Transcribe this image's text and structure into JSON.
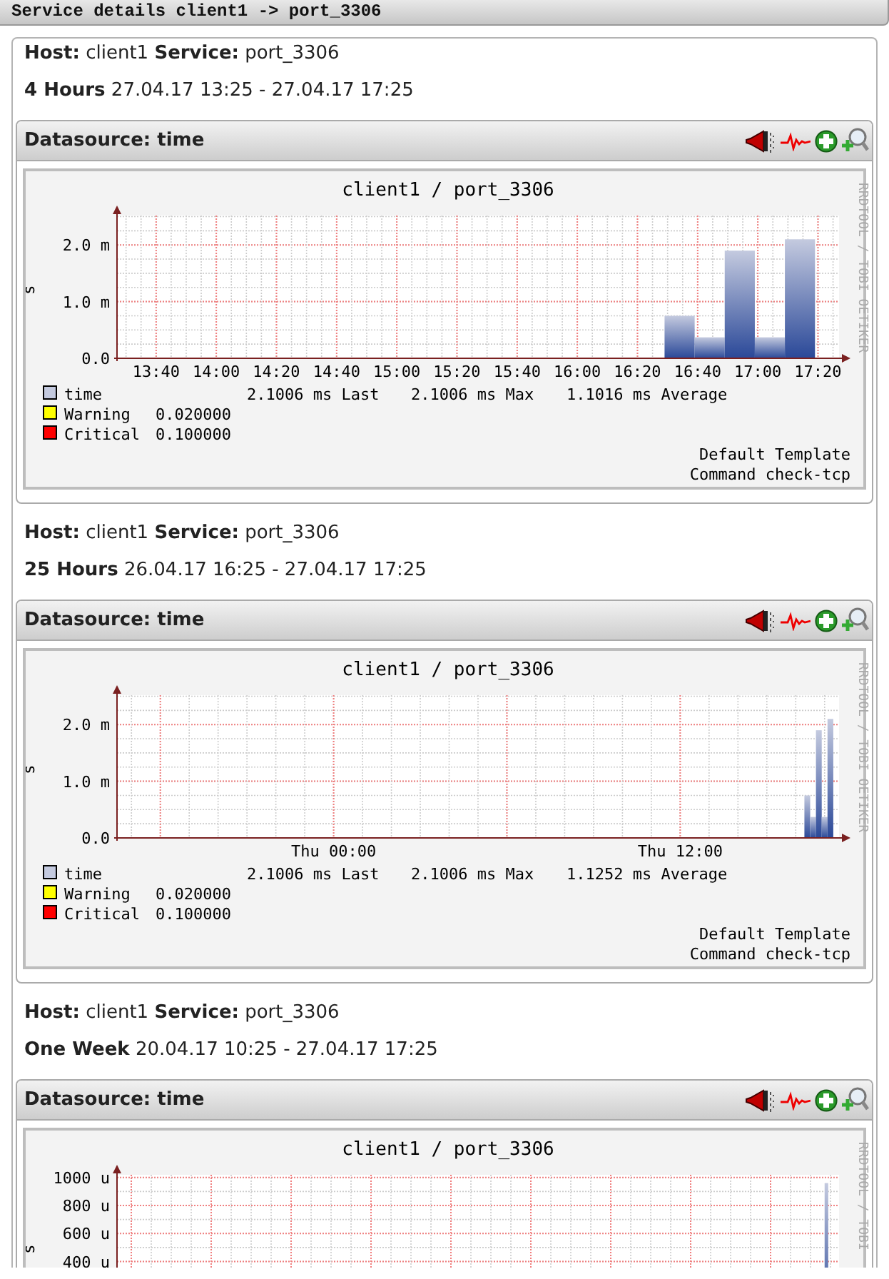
{
  "header": {
    "title": "Service details client1 -> port_3306"
  },
  "sections": [
    {
      "host_label": "Host:",
      "host": "client1",
      "service_label": "Service:",
      "service": "port_3306",
      "period": "4 Hours",
      "range": "27.04.17 13:25 - 27.04.17 17:25",
      "datasource": "Datasource: time",
      "graph": {
        "credit": "RRDTOOL / TOBI OETIKER",
        "legend": [
          {
            "stats": [
              "2.1006 ms Last",
              "2.1006 ms Max",
              "1.1016 ms Average"
            ]
          },
          {
            "label": "Warning",
            "color": "#ffff00",
            "value": "0.020000"
          },
          {
            "label": "Critical",
            "color": "#ff0000",
            "value": "0.100000"
          }
        ],
        "footer": [
          "Default Template",
          "Command check-tcp"
        ],
        "chart_data": {
          "type": "bar",
          "title": "client1 / port_3306",
          "ylabel": "s",
          "grid": true,
          "x": [
            994,
            1004,
            1014,
            1024,
            1034
          ],
          "series": [
            {
              "name": "time",
              "color": "#c4cadf",
              "values": [
                0.75,
                0.37,
                1.9,
                0.37,
                2.1
              ]
            }
          ],
          "xlim": [
            807,
            1047
          ],
          "ylim": [
            0,
            2.62
          ],
          "xticks": [
            {
              "value": 820,
              "label": "13:40"
            },
            {
              "value": 840,
              "label": "14:00"
            },
            {
              "value": 860,
              "label": "14:20"
            },
            {
              "value": 880,
              "label": "14:40"
            },
            {
              "value": 900,
              "label": "15:00"
            },
            {
              "value": 920,
              "label": "15:20"
            },
            {
              "value": 940,
              "label": "15:40"
            },
            {
              "value": 960,
              "label": "16:00"
            },
            {
              "value": 980,
              "label": "16:20"
            },
            {
              "value": 1000,
              "label": "16:40"
            },
            {
              "value": 1020,
              "label": "17:00"
            },
            {
              "value": 1040,
              "label": "17:20"
            }
          ],
          "yticks": [
            {
              "value": 0,
              "label": "0.0"
            },
            {
              "value": 1,
              "label": "1.0 m"
            },
            {
              "value": 2,
              "label": "2.0 m"
            }
          ]
        }
      }
    },
    {
      "host_label": "Host:",
      "host": "client1",
      "service_label": "Service:",
      "service": "port_3306",
      "period": "25 Hours",
      "range": "26.04.17 16:25 - 27.04.17 17:25",
      "datasource": "Datasource: time",
      "graph": {
        "credit": "RRDTOOL / TOBI OETIKER",
        "legend": [
          {
            "stats": [
              "2.1006 ms Last",
              "2.1006 ms Max",
              "1.1252 ms Average"
            ]
          },
          {
            "label": "Warning",
            "color": "#ffff00",
            "value": "0.020000"
          },
          {
            "label": "Critical",
            "color": "#ff0000",
            "value": "0.100000"
          }
        ],
        "footer": [
          "Default Template",
          "Command check-tcp"
        ],
        "chart_data": {
          "type": "bar",
          "title": "client1 / port_3306",
          "ylabel": "s",
          "grid": true,
          "categories": [
            null,
            null,
            null,
            null,
            null,
            null,
            null,
            null,
            null,
            null,
            null,
            null,
            null,
            null,
            null,
            null,
            null,
            null,
            null,
            null,
            null,
            null,
            null,
            null,
            null,
            null,
            null,
            null,
            null,
            null,
            null,
            null,
            null,
            null,
            null,
            null,
            null,
            "Thu 00:00",
            null,
            null,
            null,
            null,
            null,
            null,
            null,
            null,
            null,
            null,
            null,
            null,
            null,
            null,
            null,
            null,
            null,
            null,
            null,
            null,
            null,
            null,
            null,
            null,
            null,
            null,
            null,
            null,
            null,
            null,
            null,
            null,
            null,
            null,
            null,
            null,
            null,
            null,
            null,
            null,
            null,
            null,
            null,
            null,
            null,
            null,
            null,
            null,
            null,
            null,
            null,
            null,
            null,
            null,
            null,
            null,
            null,
            null,
            null,
            "Thu 12:00",
            null,
            null,
            null,
            null,
            null,
            null,
            null,
            null,
            null,
            null,
            null,
            null,
            null,
            null,
            null,
            null,
            null,
            null,
            null,
            null,
            null,
            null,
            null,
            null,
            null,
            null,
            null
          ],
          "series": [
            {
              "name": "time",
              "color": "#c4cadf",
              "values": [
                null,
                null,
                null,
                null,
                null,
                null,
                null,
                null,
                null,
                null,
                null,
                null,
                null,
                null,
                null,
                null,
                null,
                null,
                null,
                null,
                null,
                null,
                null,
                null,
                null,
                null,
                null,
                null,
                null,
                null,
                null,
                null,
                null,
                null,
                null,
                null,
                null,
                null,
                null,
                null,
                null,
                null,
                null,
                null,
                null,
                null,
                null,
                null,
                null,
                null,
                null,
                null,
                null,
                null,
                null,
                null,
                null,
                null,
                null,
                null,
                null,
                null,
                null,
                null,
                null,
                null,
                null,
                null,
                null,
                null,
                null,
                null,
                null,
                null,
                null,
                null,
                null,
                null,
                null,
                null,
                null,
                null,
                null,
                null,
                null,
                null,
                null,
                null,
                null,
                null,
                null,
                null,
                null,
                null,
                null,
                null,
                null,
                null,
                null,
                null,
                null,
                null,
                null,
                null,
                null,
                null,
                null,
                null,
                null,
                null,
                null,
                null,
                null,
                null,
                null,
                null,
                null,
                null,
                null,
                0.75,
                0.37,
                1.9,
                0.37,
                2.1,
                null
              ]
            }
          ],
          "ylim": [
            0,
            2.62
          ],
          "yticks": [
            {
              "value": 0,
              "label": "0.0"
            },
            {
              "value": 1,
              "label": "1.0 m"
            },
            {
              "value": 2,
              "label": "2.0 m"
            }
          ]
        }
      }
    },
    {
      "host_label": "Host:",
      "host": "client1",
      "service_label": "Service:",
      "service": "port_3306",
      "period": "One Week",
      "range": "20.04.17 10:25 - 27.04.17 17:25",
      "datasource": "Datasource: time",
      "graph": {
        "credit": "RRDTOOL / TOBI",
        "chart_data": {
          "type": "bar",
          "title": "client1 / port_3306",
          "ylabel": "s",
          "grid": true,
          "ylim": [
            0,
            1060
          ],
          "categories": [
            null,
            null,
            null,
            null,
            null,
            null,
            null,
            null,
            null,
            null,
            null,
            null,
            null,
            null,
            null,
            null,
            null,
            null,
            null,
            null,
            null,
            null,
            null,
            null,
            null,
            null,
            null,
            null,
            null,
            null,
            null,
            null,
            null,
            null,
            null,
            null,
            null,
            null,
            null,
            null,
            null,
            null,
            null,
            null,
            null,
            null,
            null,
            null,
            null,
            null,
            null,
            null,
            null,
            null,
            null,
            null,
            null,
            null,
            null,
            null,
            null,
            null,
            null,
            null,
            null,
            null,
            null,
            null,
            null,
            null,
            null,
            null,
            null,
            null,
            null,
            null,
            null,
            null,
            null,
            null,
            null,
            null,
            null,
            null,
            null,
            null,
            null,
            null,
            null,
            null,
            null,
            null,
            null,
            null,
            null,
            null,
            null,
            null,
            null,
            null,
            null,
            null,
            null,
            null,
            null,
            null,
            null,
            null,
            null,
            null,
            null,
            null,
            null,
            null,
            null,
            null,
            null,
            null,
            null,
            null,
            null,
            null,
            null,
            null,
            null,
            null,
            null,
            null,
            null,
            null,
            null,
            null,
            null,
            null,
            null,
            null,
            null,
            null,
            null,
            null,
            null,
            null,
            null,
            null,
            null,
            null,
            null,
            null,
            null,
            null,
            null,
            null,
            null,
            null,
            null,
            null,
            null,
            null,
            null,
            null,
            null,
            null,
            null,
            null,
            null,
            null,
            null,
            null,
            null,
            null,
            null,
            null,
            null,
            null,
            null,
            null,
            null,
            null,
            null,
            null,
            null,
            null,
            null,
            null,
            null,
            null,
            null,
            null,
            null,
            null,
            null,
            null,
            null,
            null,
            null,
            null,
            null,
            null,
            null,
            null
          ],
          "series": [
            {
              "color": "#c4cadf",
              "values": [
                null,
                null,
                null,
                null,
                null,
                null,
                null,
                null,
                null,
                null,
                null,
                null,
                null,
                null,
                null,
                null,
                null,
                null,
                null,
                null,
                null,
                null,
                null,
                null,
                null,
                null,
                null,
                null,
                null,
                null,
                null,
                null,
                null,
                null,
                null,
                null,
                null,
                null,
                null,
                null,
                null,
                null,
                null,
                null,
                null,
                null,
                null,
                null,
                null,
                null,
                null,
                null,
                null,
                null,
                null,
                null,
                null,
                null,
                null,
                null,
                null,
                null,
                null,
                null,
                null,
                null,
                null,
                null,
                null,
                null,
                null,
                null,
                null,
                null,
                null,
                null,
                null,
                null,
                null,
                null,
                null,
                null,
                null,
                null,
                null,
                null,
                null,
                null,
                null,
                null,
                null,
                null,
                null,
                null,
                null,
                null,
                null,
                null,
                null,
                null,
                null,
                null,
                null,
                null,
                null,
                null,
                null,
                null,
                null,
                null,
                null,
                null,
                null,
                null,
                null,
                null,
                null,
                null,
                null,
                null,
                null,
                null,
                null,
                null,
                null,
                null,
                null,
                null,
                null,
                null,
                null,
                null,
                null,
                null,
                null,
                null,
                null,
                null,
                null,
                null,
                null,
                null,
                null,
                null,
                null,
                null,
                null,
                null,
                null,
                null,
                null,
                null,
                null,
                null,
                null,
                null,
                null,
                null,
                null,
                null,
                null,
                null,
                null,
                null,
                null,
                null,
                null,
                null,
                null,
                null,
                null,
                null,
                null,
                null,
                null,
                null,
                null,
                null,
                null,
                null,
                null,
                null,
                null,
                null,
                null,
                null,
                null,
                null,
                null,
                null,
                null,
                null,
                null,
                null,
                null,
                null,
                960,
                null,
                null,
                null
              ]
            }
          ],
          "yticks": [
            {
              "value": 400,
              "label": "400 u"
            },
            {
              "value": 600,
              "label": "600 u"
            },
            {
              "value": 800,
              "label": "800 u"
            },
            {
              "value": 1000,
              "label": "1000 u"
            }
          ]
        }
      }
    }
  ]
}
